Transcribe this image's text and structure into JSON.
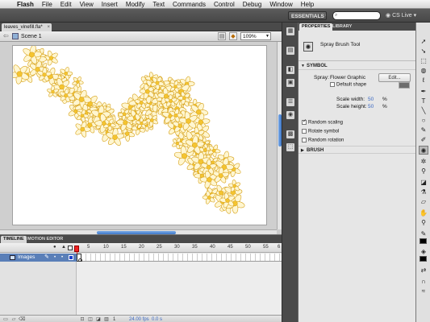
{
  "menubar": {
    "items": [
      "Flash",
      "File",
      "Edit",
      "View",
      "Insert",
      "Modify",
      "Text",
      "Commands",
      "Control",
      "Debug",
      "Window",
      "Help"
    ]
  },
  "appbar": {
    "workspace": "ESSENTIALS ▾",
    "search_placeholder": "",
    "cslive": "CS Live ▾"
  },
  "document": {
    "tab_label": "leaves_vinefill.fla*",
    "scene": "Scene 1",
    "zoom": "109%"
  },
  "timeline": {
    "tabs": [
      "TIMELINE",
      "MOTION EDITOR"
    ],
    "ruler": [
      "5",
      "10",
      "15",
      "20",
      "25",
      "30",
      "35",
      "40",
      "45",
      "50",
      "55",
      "6"
    ],
    "layer_name": "Images",
    "frame": "1",
    "fps": "24.00 fps",
    "time": "0.0 s"
  },
  "properties": {
    "tabs": [
      "PROPERTIES",
      "LIBRARY"
    ],
    "tool_name": "Spray Brush Tool",
    "section_symbol": "SYMBOL",
    "spray_label": "Spray:",
    "spray_value": "Flower Graphic",
    "edit_button": "Edit...",
    "default_shape": "Default shape",
    "scale_width_label": "Scale width:",
    "scale_width_value": "50",
    "scale_height_label": "Scale height:",
    "scale_height_value": "50",
    "percent": "%",
    "random_scaling": "Random scaling",
    "rotate_symbol": "Rotate symbol",
    "random_rotation": "Random rotation",
    "section_brush": "BRUSH"
  },
  "colors": {
    "accent_blue": "#3d78c9",
    "flower_fill": "#f4c430",
    "flower_outline": "#d7a21b",
    "layer_highlight": "#5a7fb8"
  }
}
